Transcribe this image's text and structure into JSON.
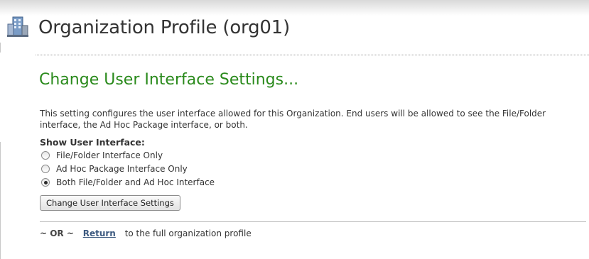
{
  "header": {
    "title": "Organization Profile (org01)",
    "icon": "organization-building-icon"
  },
  "section": {
    "heading": "Change User Interface Settings...",
    "description": "This setting configures the user interface allowed for this Organization. End users will be allowed to see the File/Folder interface, the Ad Hoc Package interface, or both.",
    "heading_color": "#2a8a1c"
  },
  "interface_options": {
    "label": "Show User Interface:",
    "options": [
      {
        "label": "File/Folder Interface Only",
        "selected": false
      },
      {
        "label": "Ad Hoc Package Interface Only",
        "selected": false
      },
      {
        "label": "Both File/Folder and Ad Hoc Interface",
        "selected": true
      }
    ]
  },
  "actions": {
    "submit_label": "Change User Interface Settings"
  },
  "footer": {
    "or_text": "~ OR ~",
    "return_link": "Return",
    "suffix": "to the full organization profile"
  }
}
